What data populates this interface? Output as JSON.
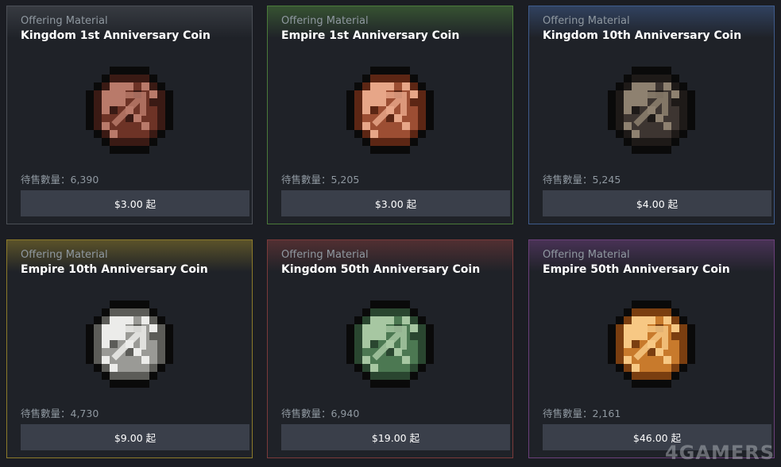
{
  "cards": [
    {
      "category": "Offering Material",
      "name": "Kingdom 1st Anniversary Coin",
      "stock": "待售數量：6,390",
      "price": "$3.00 起",
      "rarity_color": "#4b4f56",
      "coin": {
        "icon": "kingdom-1st-coin-icon",
        "base": "#6d3326",
        "light": "#b97a6a",
        "dark": "#3a1a14"
      }
    },
    {
      "category": "Offering Material",
      "name": "Empire 1st Anniversary Coin",
      "stock": "待售數量：5,205",
      "price": "$3.00 起",
      "rarity_color": "#4a7a3a",
      "coin": {
        "icon": "empire-1st-coin-icon",
        "base": "#9c4e33",
        "light": "#e7a688",
        "dark": "#5c2614"
      }
    },
    {
      "category": "Offering Material",
      "name": "Kingdom 10th Anniversary Coin",
      "stock": "待售數量：5,245",
      "price": "$4.00 起",
      "rarity_color": "#3f5b8c",
      "coin": {
        "icon": "kingdom-10th-coin-icon",
        "base": "#3d3531",
        "light": "#8e8170",
        "dark": "#1e1a18"
      }
    },
    {
      "category": "Offering Material",
      "name": "Empire 10th Anniversary Coin",
      "stock": "待售數量：4,730",
      "price": "$9.00 起",
      "rarity_color": "#8c7a2a",
      "coin": {
        "icon": "empire-10th-coin-icon",
        "base": "#9a9a96",
        "light": "#ececea",
        "dark": "#5c5c58"
      }
    },
    {
      "category": "Offering Material",
      "name": "Kingdom 50th Anniversary Coin",
      "stock": "待售數量：6,940",
      "price": "$19.00 起",
      "rarity_color": "#7a3a3a",
      "coin": {
        "icon": "kingdom-50th-coin-icon",
        "base": "#4c7852",
        "light": "#a7c7a2",
        "dark": "#2a4630"
      }
    },
    {
      "category": "Offering Material",
      "name": "Empire 50th Anniversary Coin",
      "stock": "待售數量：2,161",
      "price": "$46.00 起",
      "rarity_color": "#6a3f7a",
      "coin": {
        "icon": "empire-50th-coin-icon",
        "base": "#c87a2c",
        "light": "#f7c884",
        "dark": "#7a3e10"
      }
    }
  ],
  "watermark": "4GAMERS"
}
